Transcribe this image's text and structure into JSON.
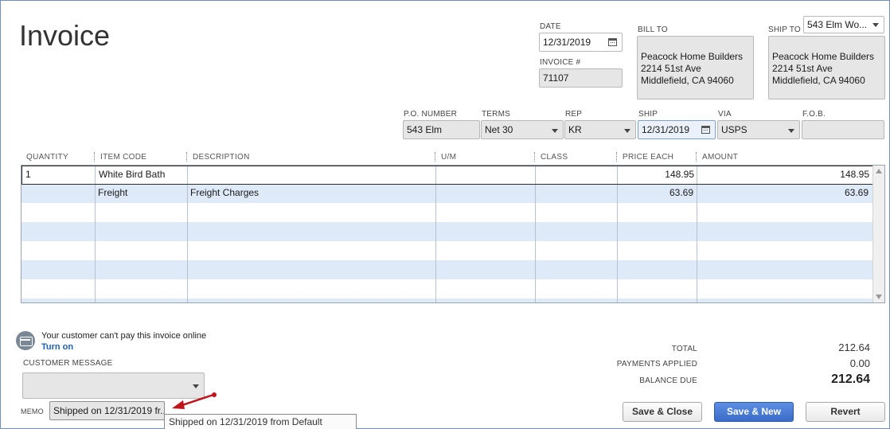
{
  "form": {
    "title": "Invoice"
  },
  "header": {
    "date_label": "DATE",
    "date_value": "12/31/2019",
    "invoice_no_label": "INVOICE #",
    "invoice_no_value": "71107",
    "bill_to_label": "BILL TO",
    "bill_to_lines": [
      "Peacock Home Builders",
      "2214 51st Ave",
      "Middlefield, CA 94060"
    ],
    "ship_to_label": "SHIP TO",
    "ship_to_select": "543 Elm Wo...",
    "ship_to_lines": [
      "Peacock Home Builders",
      "2214 51st Ave",
      "Middlefield, CA 94060"
    ]
  },
  "details": {
    "po_label": "P.O. NUMBER",
    "po_value": "543 Elm",
    "terms_label": "TERMS",
    "terms_value": "Net 30",
    "rep_label": "REP",
    "rep_value": "KR",
    "ship_label": "SHIP",
    "ship_value": "12/31/2019",
    "via_label": "VIA",
    "via_value": "USPS",
    "fob_label": "F.O.B.",
    "fob_value": ""
  },
  "table": {
    "columns": [
      "QUANTITY",
      "ITEM CODE",
      "DESCRIPTION",
      "U/M",
      "CLASS",
      "PRICE EACH",
      "AMOUNT"
    ],
    "rows": [
      {
        "quantity": "1",
        "item_code": "White Bird Bath",
        "description": "",
        "um": "",
        "class": "",
        "price_each": "148.95",
        "amount": "148.95"
      },
      {
        "quantity": "",
        "item_code": "Freight",
        "description": "Freight Charges",
        "um": "",
        "class": "",
        "price_each": "63.69",
        "amount": "63.69"
      }
    ]
  },
  "online": {
    "message": "Your customer can't pay this invoice online",
    "turn_on": "Turn on"
  },
  "customer_message": {
    "label": "CUSTOMER MESSAGE",
    "value": ""
  },
  "memo": {
    "label": "MEMO",
    "value": "Shipped on 12/31/2019 fr...",
    "tooltip": "Shipped on 12/31/2019 from Default"
  },
  "totals": {
    "total_label": "TOTAL",
    "total_value": "212.64",
    "payments_label": "PAYMENTS APPLIED",
    "payments_value": "0.00",
    "balance_label": "BALANCE DUE",
    "balance_value": "212.64"
  },
  "buttons": {
    "save_close": "Save & Close",
    "save_new": "Save & New",
    "revert": "Revert"
  },
  "colors": {
    "accent": "#3a6cc9",
    "row_alt": "#deeaf8",
    "arrow": "#c0141b"
  },
  "icons": {
    "calendar": "calendar-icon",
    "dropdown": "chevron-down-icon",
    "online_payment": "credit-card-icon"
  }
}
